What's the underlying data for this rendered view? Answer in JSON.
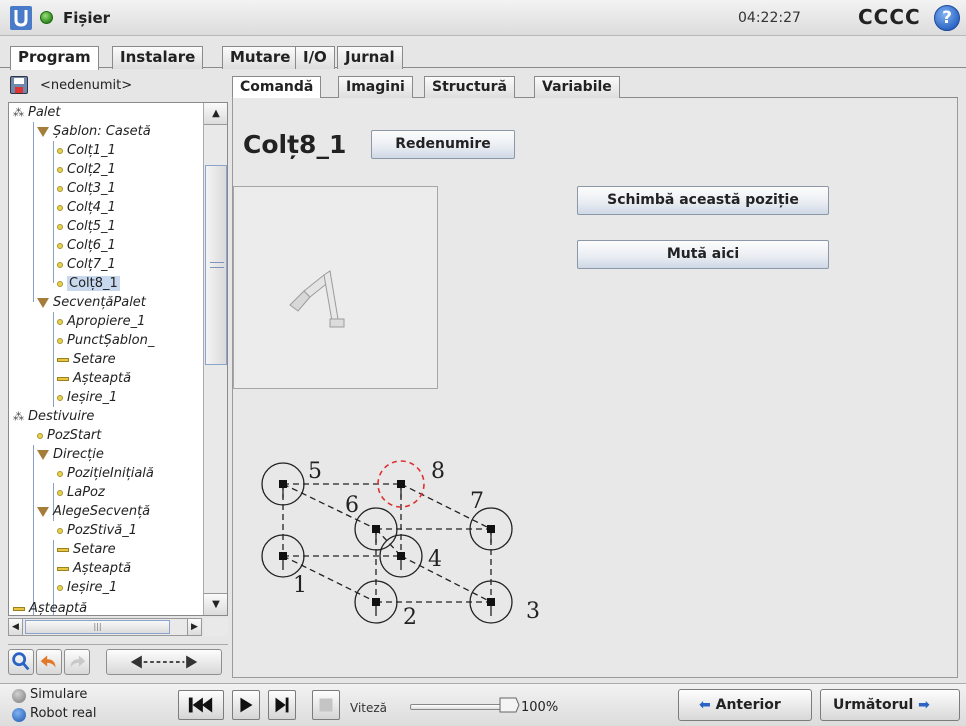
{
  "titlebar": {
    "file_label": "Fișier",
    "clock": "04:22:27",
    "robot_name": "CCCC",
    "help_glyph": "?"
  },
  "main_tabs": [
    "Program",
    "Instalare",
    "Mutare",
    "I/O",
    "Jurnal"
  ],
  "program": {
    "name": "<nedenumit>"
  },
  "tree": {
    "items": [
      {
        "label": "Palet",
        "icon": "pallet-icon"
      },
      {
        "label": "Șablon: Casetă",
        "icon": "triangle-icon"
      },
      {
        "label": "Colț1_1",
        "icon": "waypoint-icon"
      },
      {
        "label": "Colț2_1",
        "icon": "waypoint-icon"
      },
      {
        "label": "Colț3_1",
        "icon": "waypoint-icon"
      },
      {
        "label": "Colț4_1",
        "icon": "waypoint-icon"
      },
      {
        "label": "Colț5_1",
        "icon": "waypoint-icon"
      },
      {
        "label": "Colț6_1",
        "icon": "waypoint-icon"
      },
      {
        "label": "Colț7_1",
        "icon": "waypoint-icon"
      },
      {
        "label": "Colț8_1",
        "icon": "waypoint-icon",
        "selected": true
      },
      {
        "label": "SecvențăPalet",
        "icon": "triangle-icon"
      },
      {
        "label": "Apropiere_1",
        "icon": "waypoint-icon"
      },
      {
        "label": "PunctȘablon_",
        "icon": "waypoint-icon"
      },
      {
        "label": "Setare",
        "icon": "bar-icon"
      },
      {
        "label": "Așteaptă",
        "icon": "bar-icon"
      },
      {
        "label": "Ieșire_1",
        "icon": "waypoint-icon"
      },
      {
        "label": "Destivuire",
        "icon": "pallet-icon"
      },
      {
        "label": "PozStart",
        "icon": "waypoint-icon"
      },
      {
        "label": "Direcție",
        "icon": "triangle-icon"
      },
      {
        "label": "PozițieInițială",
        "icon": "waypoint-icon"
      },
      {
        "label": "LaPoz",
        "icon": "waypoint-icon"
      },
      {
        "label": "AlegeSecvență",
        "icon": "triangle-icon"
      },
      {
        "label": "PozStivă_1",
        "icon": "waypoint-icon"
      },
      {
        "label": "Setare",
        "icon": "bar-icon"
      },
      {
        "label": "Așteaptă",
        "icon": "bar-icon"
      },
      {
        "label": "Ieșire_1",
        "icon": "waypoint-icon"
      },
      {
        "label": "Așteaptă",
        "icon": "bar-icon"
      }
    ]
  },
  "sub_tabs": [
    "Comandă",
    "Imagini",
    "Structură",
    "Variabile"
  ],
  "position": {
    "title": "Colț8_1",
    "rename_label": "Redenumire",
    "change_position_label": "Schimbă această poziție",
    "move_here_label": "Mută aici"
  },
  "pattern": {
    "labels": [
      "5",
      "8",
      "6",
      "7",
      "4",
      "1",
      "2",
      "3"
    ],
    "highlight_color": "#e03030"
  },
  "bottom": {
    "simulation_label": "Simulare",
    "real_robot_label": "Robot real",
    "speed_label": "Viteză",
    "speed_value": "100%",
    "speed_fraction": 1.0,
    "previous_label": "Anterior",
    "next_label": "Următorul"
  },
  "colors": {
    "accent": "#2a63c4",
    "selection": "#c8d8ee",
    "active_indicator": "#2e8b1e"
  }
}
